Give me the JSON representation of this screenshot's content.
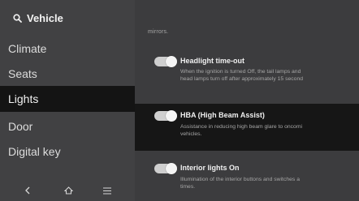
{
  "sidebar": {
    "search_label": "Vehicle",
    "search_icon": "search-icon",
    "items": [
      {
        "label": "Climate"
      },
      {
        "label": "Seats"
      },
      {
        "label": "Lights"
      },
      {
        "label": "Door"
      },
      {
        "label": "Digital key"
      }
    ],
    "selected": "Lights",
    "nav": [
      "back-icon",
      "home-icon",
      "menu-icon"
    ]
  },
  "main": {
    "mirrors_text": "mirrors.",
    "settings": [
      {
        "title": "Headlight time-out",
        "desc_line1": "When the ignition is turned Off, the tail lamps and",
        "desc_line2": "head lamps turn off after approximately 15 second",
        "enabled": true
      },
      {
        "title": "HBA (High Beam Assist)",
        "desc_line1": "Assistance in reducing high beam glare to oncomi",
        "desc_line2": "vehicles.",
        "enabled": true
      },
      {
        "title": "Interior lights On",
        "desc_line1": "Illumination of the interior buttons and switches a",
        "desc_line2": "times.",
        "enabled": true
      }
    ]
  },
  "colors": {
    "background": "#3c3c3e",
    "selected_row": "#141414",
    "toggle_on": "#cfcfcf"
  }
}
